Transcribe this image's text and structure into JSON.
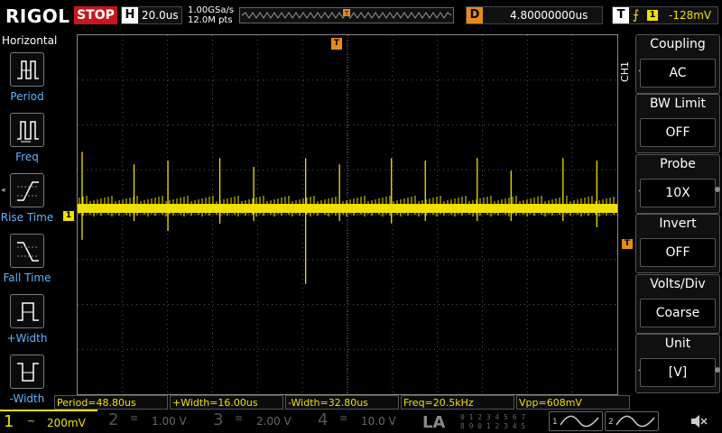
{
  "header": {
    "brand": "RIGOL",
    "run_state": "STOP",
    "horizontal": {
      "label": "H",
      "value": "20.0us"
    },
    "sample_rate": "1.00GSa/s",
    "memory_depth": "12.0M pts",
    "delay": {
      "label": "D",
      "value": "4.80000000us"
    },
    "trigger": {
      "label": "T",
      "slope_symbol": "⨍",
      "channel": "1",
      "level": "-128mV"
    }
  },
  "left_menu": {
    "title": "Horizontal",
    "items": [
      {
        "label": "Period",
        "icon": "period-icon"
      },
      {
        "label": "Freq",
        "icon": "freq-icon"
      },
      {
        "label": "Rise Time",
        "icon": "rise-time-icon"
      },
      {
        "label": "Fall Time",
        "icon": "fall-time-icon"
      },
      {
        "label": "+Width",
        "icon": "positive-width-icon"
      },
      {
        "label": "-Width",
        "icon": "negative-width-icon"
      }
    ]
  },
  "markers": {
    "ch1": "1",
    "trigger_top": "T",
    "trigger_right": "T"
  },
  "measurements": [
    "Period=48.80us",
    "+Width=16.00us",
    "-Width=32.80us",
    "Freq=20.5kHz",
    "Vpp=608mV"
  ],
  "right_menu": {
    "channel_tag": "CH1",
    "items": [
      {
        "title": "Coupling",
        "value": "AC"
      },
      {
        "title": "BW Limit",
        "value": "OFF"
      },
      {
        "title": "Probe",
        "value": "10X"
      },
      {
        "title": "Invert",
        "value": "OFF"
      },
      {
        "title": "Volts/Div",
        "value": "Coarse"
      },
      {
        "title": "Unit",
        "value": "[V]"
      }
    ]
  },
  "status_bar": {
    "channels": [
      {
        "num": "1",
        "coupling": "~",
        "scale": "200mV"
      },
      {
        "num": "2",
        "coupling": "≡",
        "scale": "1.00 V"
      },
      {
        "num": "3",
        "coupling": "≡",
        "scale": "2.00 V"
      },
      {
        "num": "4",
        "coupling": "≡",
        "scale": "10.0 V"
      }
    ],
    "la_label": "LA",
    "la_digits_top": "0 1 2 3  4 5 6 7",
    "la_digits_bottom": "8 9 0 1  2 3 4 5",
    "gen1": "1",
    "gen2": "2"
  },
  "colors": {
    "ch1": "#f0e000",
    "trigger": "#e88a1a",
    "stop": "#c8161d",
    "menu_label": "#5fb3ff",
    "grid": "#555555"
  },
  "waveform": {
    "baseline_level": 0,
    "noise_band": 0.3,
    "spike_count": 13,
    "pulse_period_us": 48.8,
    "vpp_mV": 608
  }
}
